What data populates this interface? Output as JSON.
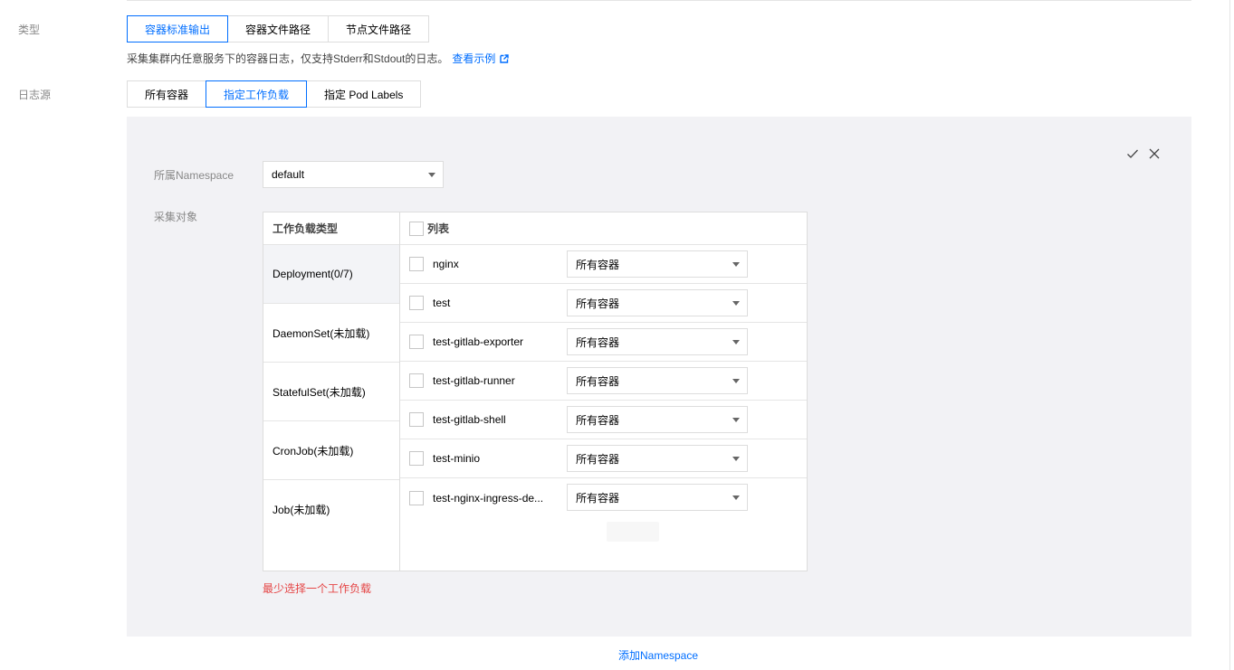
{
  "type_row": {
    "label": "类型",
    "options": [
      "容器标准输出",
      "容器文件路径",
      "节点文件路径"
    ],
    "active_index": 0,
    "hint_text": "采集集群内任意服务下的容器日志，仅支持Stderr和Stdout的日志。",
    "hint_link": "查看示例"
  },
  "source_row": {
    "label": "日志源",
    "options": [
      "所有容器",
      "指定工作负载",
      "指定 Pod Labels"
    ],
    "active_index": 1
  },
  "panel": {
    "namespace_label": "所属Namespace",
    "namespace_value": "default",
    "target_label": "采集对象",
    "table": {
      "left_header": "工作负载类型",
      "right_header": "列表",
      "workload_types": [
        "Deployment(0/7)",
        "DaemonSet(未加载)",
        "StatefulSet(未加载)",
        "CronJob(未加载)",
        "Job(未加载)"
      ],
      "workloads": [
        {
          "name": "nginx",
          "container": "所有容器"
        },
        {
          "name": "test",
          "container": "所有容器"
        },
        {
          "name": "test-gitlab-exporter",
          "container": "所有容器"
        },
        {
          "name": "test-gitlab-runner",
          "container": "所有容器"
        },
        {
          "name": "test-gitlab-shell",
          "container": "所有容器"
        },
        {
          "name": "test-minio",
          "container": "所有容器"
        },
        {
          "name": "test-nginx-ingress-de...",
          "container": "所有容器"
        }
      ]
    },
    "error_text": "最少选择一个工作负载"
  },
  "add_namespace": "添加Namespace",
  "colors": {
    "primary": "#006eff",
    "error": "#e54545",
    "panel_bg": "#f2f2f5"
  }
}
